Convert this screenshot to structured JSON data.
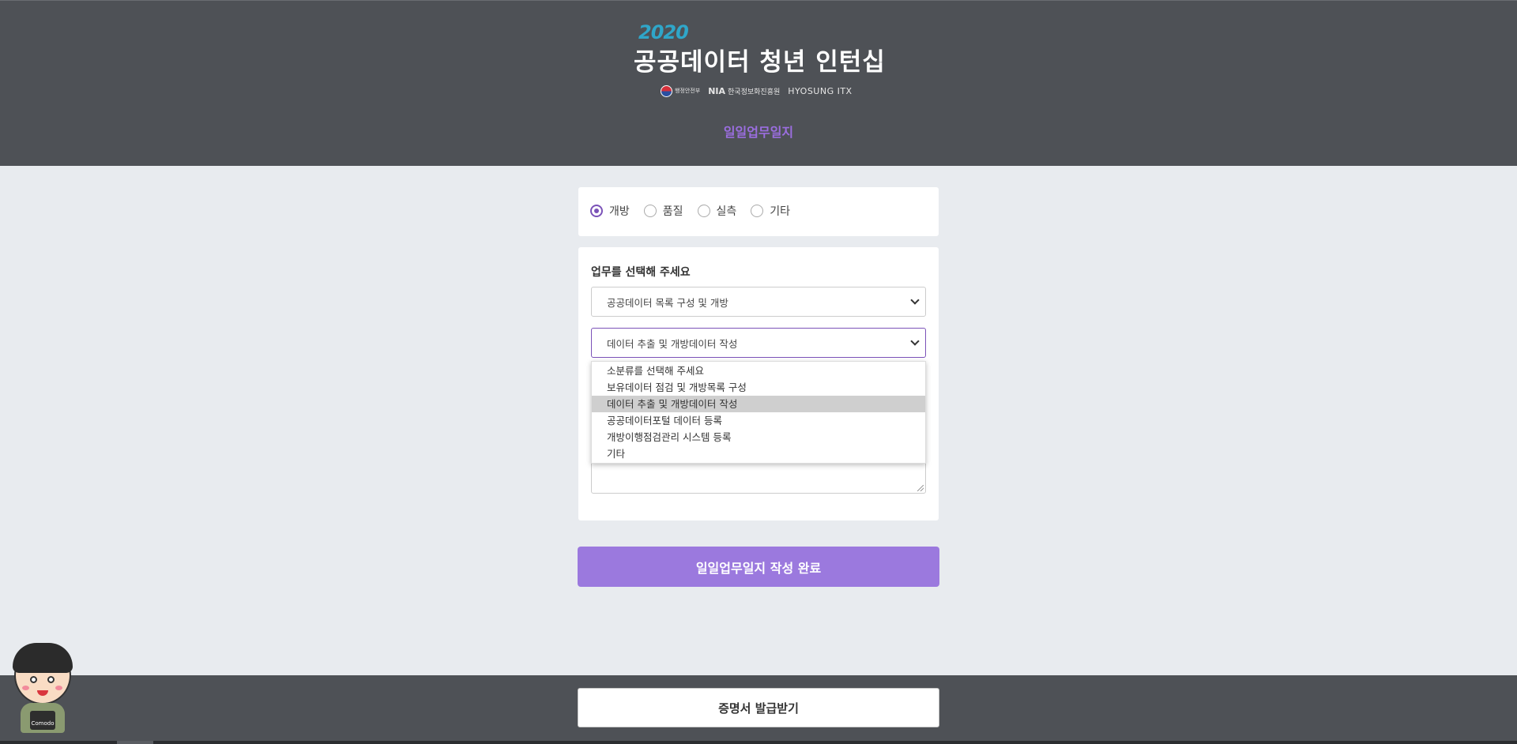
{
  "header": {
    "year": "2020",
    "title": "공공데이터 청년 인턴십",
    "logos": {
      "gov": "행정안전부",
      "nia": "NIA",
      "nia_sub": "한국정보화진흥원",
      "hyosung": "HYOSUNG ITX"
    },
    "subtitle": "일일업무일지"
  },
  "category_radios": [
    {
      "label": "개방",
      "checked": true
    },
    {
      "label": "품질",
      "checked": false
    },
    {
      "label": "실측",
      "checked": false
    },
    {
      "label": "기타",
      "checked": false
    }
  ],
  "task": {
    "label": "업무를 선택해 주세요",
    "main_select": "공공데이터 목록 구성 및 개방",
    "sub_select": "데이터 추출 및 개방데이터 작성",
    "dropdown_options": [
      "소분류를 선택해 주세요",
      "보유데이터 점검 및 개방목록 구성",
      "데이터 추출 및 개방데이터 작성",
      "공공데이터포털 데이터 등록",
      "개방이행점검관리 시스템 등록",
      "기타"
    ],
    "dropdown_selected_index": 2
  },
  "buttons": {
    "submit": "일일업무일지 작성 완료",
    "certificate": "증명서 발급받기"
  },
  "mascot": {
    "badge": "Comodo"
  },
  "colors": {
    "header_bg": "#4e5156",
    "accent_purple": "#9b79de",
    "radio_purple": "#7b52b8",
    "year_blue": "#2fa6c9",
    "page_bg": "#e8ebef"
  }
}
